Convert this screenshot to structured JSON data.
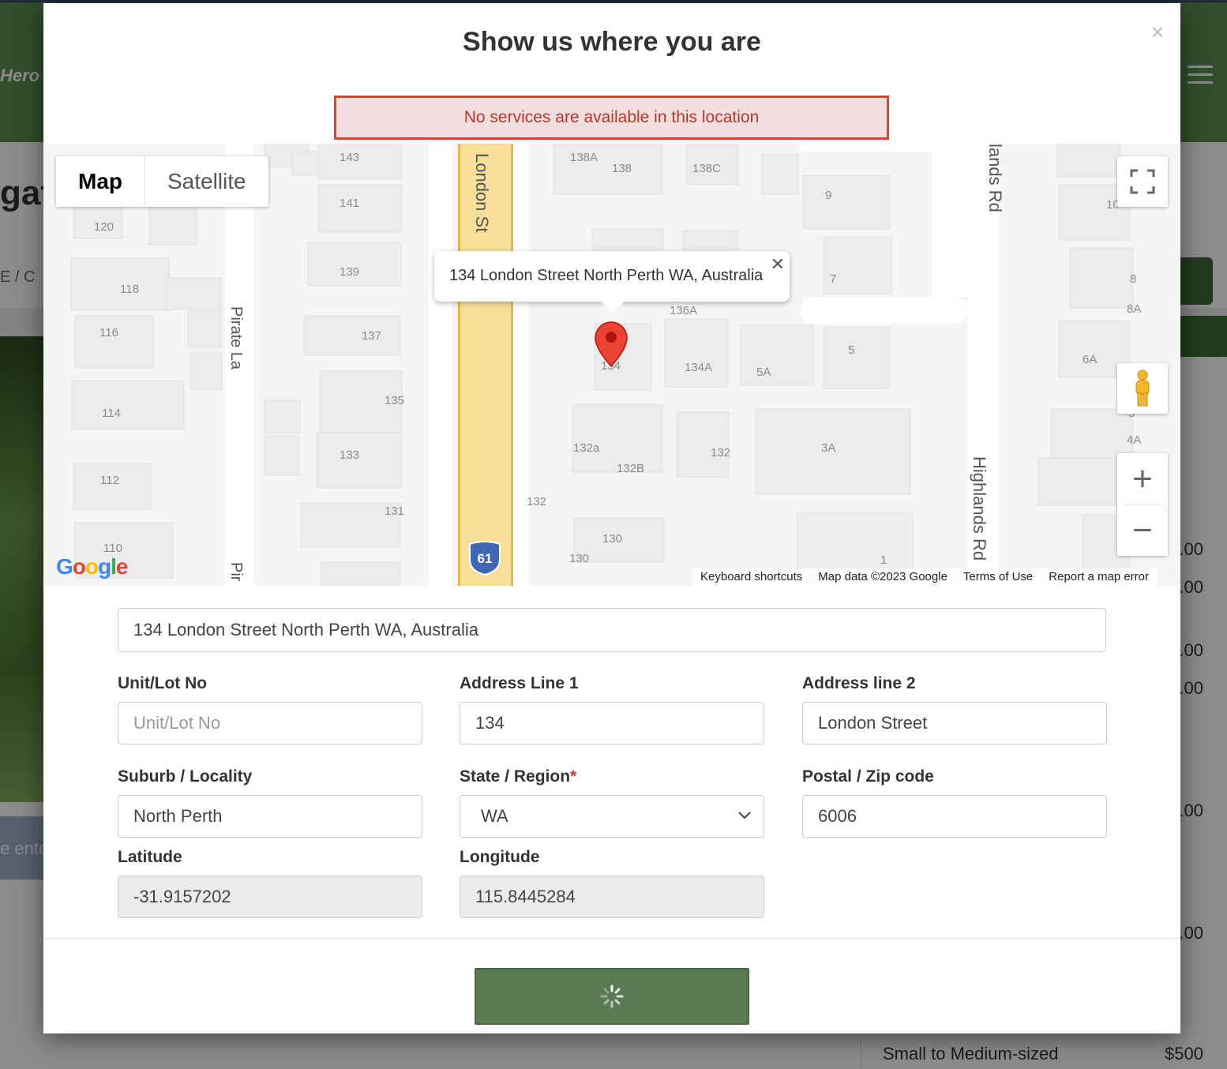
{
  "background": {
    "logo_text": "Hero",
    "title_fragment": "gat",
    "breadcrumb_fragment": "E  /  C",
    "banner_fragment": "e ente",
    "prices": [
      ".00",
      ".00",
      ".00",
      ".00",
      ".00",
      ".00"
    ],
    "bottom_row": {
      "label": "Small to Medium-sized",
      "price": "$500"
    }
  },
  "modal": {
    "title": "Show us where you are",
    "close_glyph": "×",
    "alert": "No services are available in this location"
  },
  "map": {
    "type_buttons": [
      "Map",
      "Satellite"
    ],
    "info_window": "134 London Street North Perth WA, Australia",
    "info_close": "✕",
    "footer": [
      "Keyboard shortcuts",
      "Map data ©2023 Google",
      "Terms of Use",
      "Report a map error"
    ],
    "google_logo": "Google",
    "route_shield": "61",
    "streets": [
      "London St",
      "Pirate La",
      "Pir",
      "lands Rd",
      "Highlands Rd"
    ],
    "lot_numbers": [
      "143",
      "141",
      "139",
      "137",
      "135",
      "133",
      "131",
      "120",
      "118",
      "116",
      "114",
      "112",
      "110",
      "138A",
      "138",
      "138C",
      "9",
      "7",
      "136A",
      "134",
      "134A",
      "5A",
      "5",
      "132a",
      "132B",
      "132",
      "132",
      "3A",
      "130",
      "130",
      "1",
      "8",
      "8A",
      "6A",
      "4A",
      "10",
      "5"
    ],
    "marker_color": "#ea4335",
    "road_color": "#f7df99"
  },
  "form": {
    "full_address": "134 London Street North Perth WA, Australia",
    "fields": {
      "unit": {
        "label": "Unit/Lot No",
        "placeholder": "Unit/Lot No",
        "value": ""
      },
      "address1": {
        "label": "Address Line 1",
        "value": "134"
      },
      "address2": {
        "label": "Address line 2",
        "value": "London Street"
      },
      "suburb": {
        "label": "Suburb / Locality",
        "value": "North Perth"
      },
      "state": {
        "label": "State / Region",
        "required_mark": "*",
        "value": "WA"
      },
      "postal": {
        "label": "Postal / Zip code",
        "value": "6006"
      },
      "latitude": {
        "label": "Latitude",
        "value": "-31.9157202"
      },
      "longitude": {
        "label": "Longitude",
        "value": "115.8445284"
      }
    },
    "submit_state": "loading"
  },
  "colors": {
    "brand_green": "#5c8f4f",
    "button_green": "#597a52",
    "alert_border": "#e0402c",
    "alert_text": "#b03a2e"
  }
}
